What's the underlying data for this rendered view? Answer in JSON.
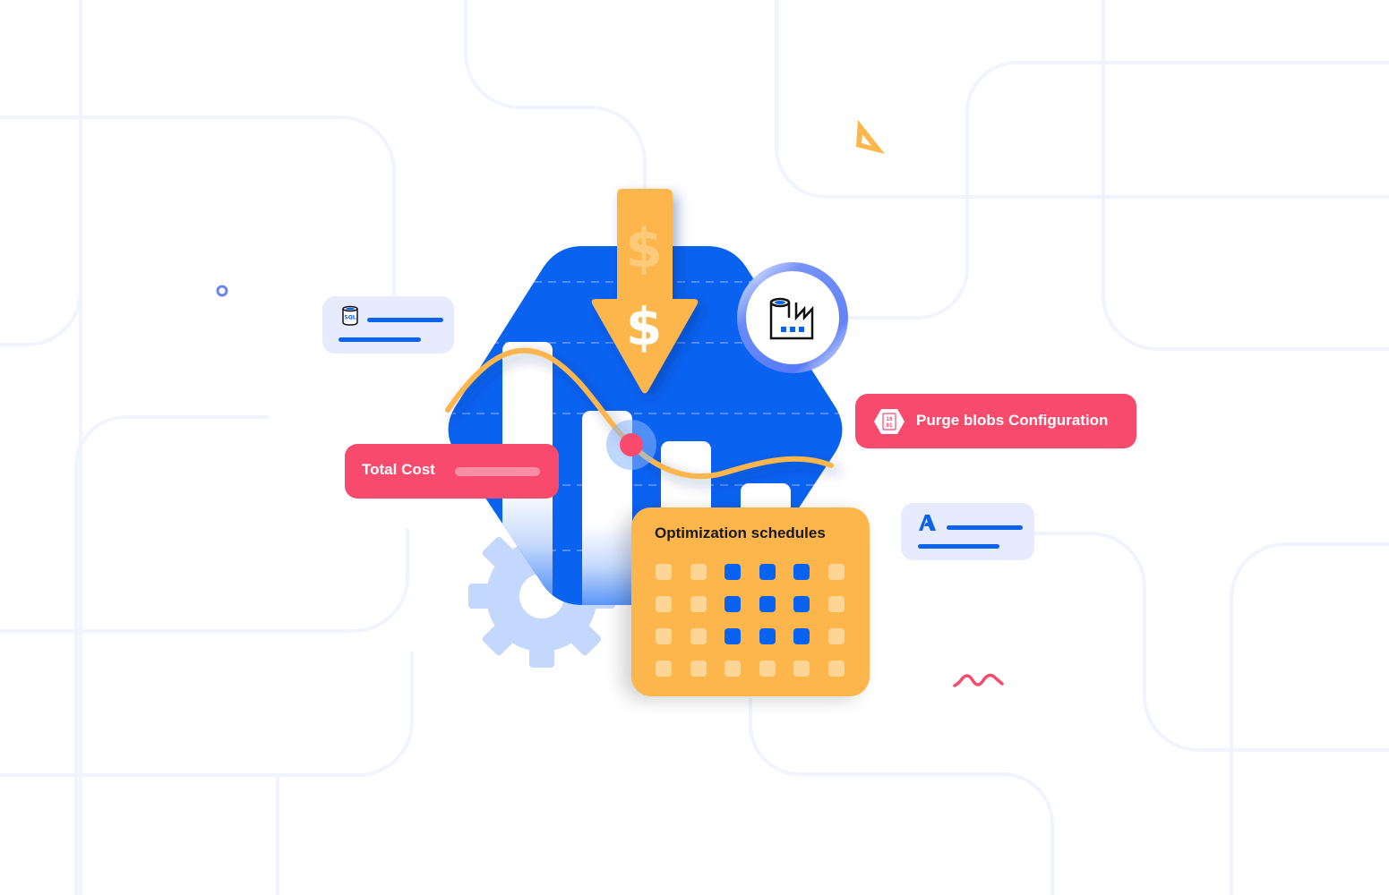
{
  "colors": {
    "brand_blue": "#0a63f0",
    "accent_pink": "#f84a6c",
    "accent_orange": "#fcb64c",
    "light_card": "#e6ebfd",
    "gear": "#c3d8fc",
    "bg_line": "#f1f4fe"
  },
  "hero": {
    "arrow_icon": "down-arrow-icon",
    "currency_symbol": "$",
    "factory_icon": "data-factory-icon"
  },
  "cards": {
    "sql": {
      "icon": "sql-database-icon",
      "icon_text": "SQL"
    },
    "azure": {
      "icon": "azure-logo-icon",
      "icon_text": "A"
    },
    "total_cost": {
      "label": "Total Cost"
    },
    "purge": {
      "icon": "blob-storage-icon",
      "icon_text": "10\n01",
      "label": "Purge blobs Configuration"
    },
    "schedules": {
      "title": "Optimization schedules",
      "grid": [
        [
          0,
          0,
          1,
          1,
          1,
          0
        ],
        [
          0,
          0,
          1,
          1,
          1,
          0
        ],
        [
          0,
          0,
          1,
          1,
          1,
          0
        ],
        [
          0,
          0,
          0,
          0,
          0,
          0
        ]
      ]
    }
  },
  "decorations": {
    "triangle_icon": "set-square-icon",
    "squiggle_icon": "squiggle-icon",
    "ring_icon": "small-ring-icon",
    "gear_icon": "gear-icon"
  }
}
